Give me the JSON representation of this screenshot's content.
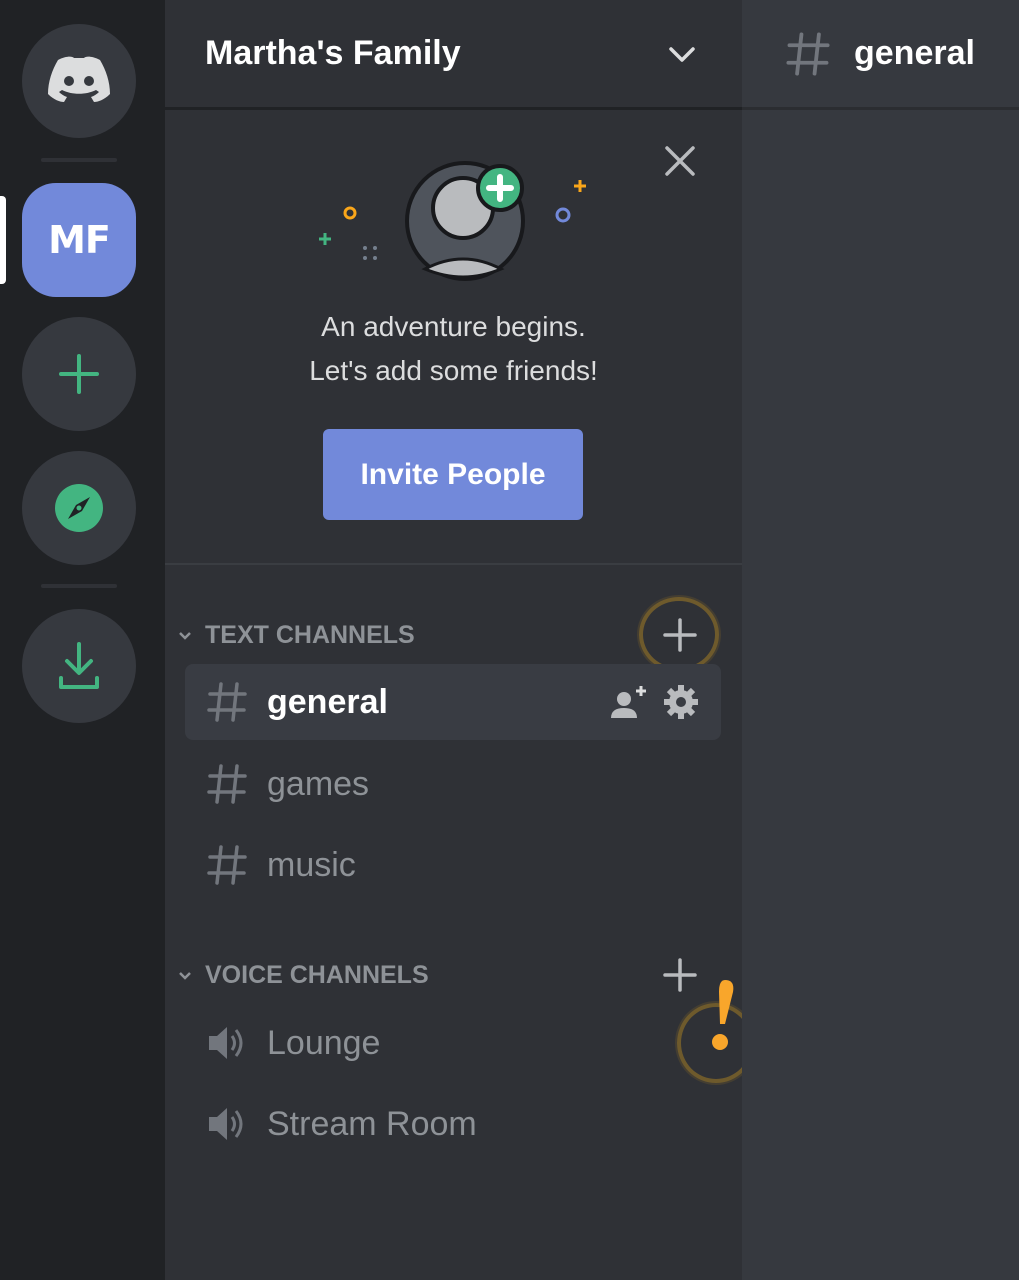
{
  "rail": {
    "home_icon": "discord-logo-icon",
    "servers": [
      {
        "initials": "MF",
        "name": "Martha's Family",
        "selected": true
      }
    ],
    "add_server_icon": "plus-icon",
    "explore_icon": "compass-icon",
    "download_icon": "download-icon"
  },
  "guild": {
    "name": "Martha's Family",
    "menu_icon": "chevron-down-icon"
  },
  "invite_card": {
    "line1": "An adventure begins.",
    "line2": "Let's add some friends!",
    "button_label": "Invite People",
    "close_icon": "close-icon"
  },
  "categories": {
    "text": {
      "label": "TEXT CHANNELS",
      "channels": [
        {
          "name": "general",
          "active": true
        },
        {
          "name": "games",
          "active": false
        },
        {
          "name": "music",
          "active": false
        }
      ]
    },
    "voice": {
      "label": "VOICE CHANNELS",
      "channels": [
        {
          "name": "Lounge"
        },
        {
          "name": "Stream Room"
        }
      ]
    }
  },
  "main": {
    "channel_name": "general"
  },
  "colors": {
    "blurple": "#7289da",
    "green": "#43b581",
    "rail_bg": "#202225",
    "sidebar_bg": "#2f3136",
    "main_bg": "#36393f",
    "annotation": "#f9a62b"
  }
}
